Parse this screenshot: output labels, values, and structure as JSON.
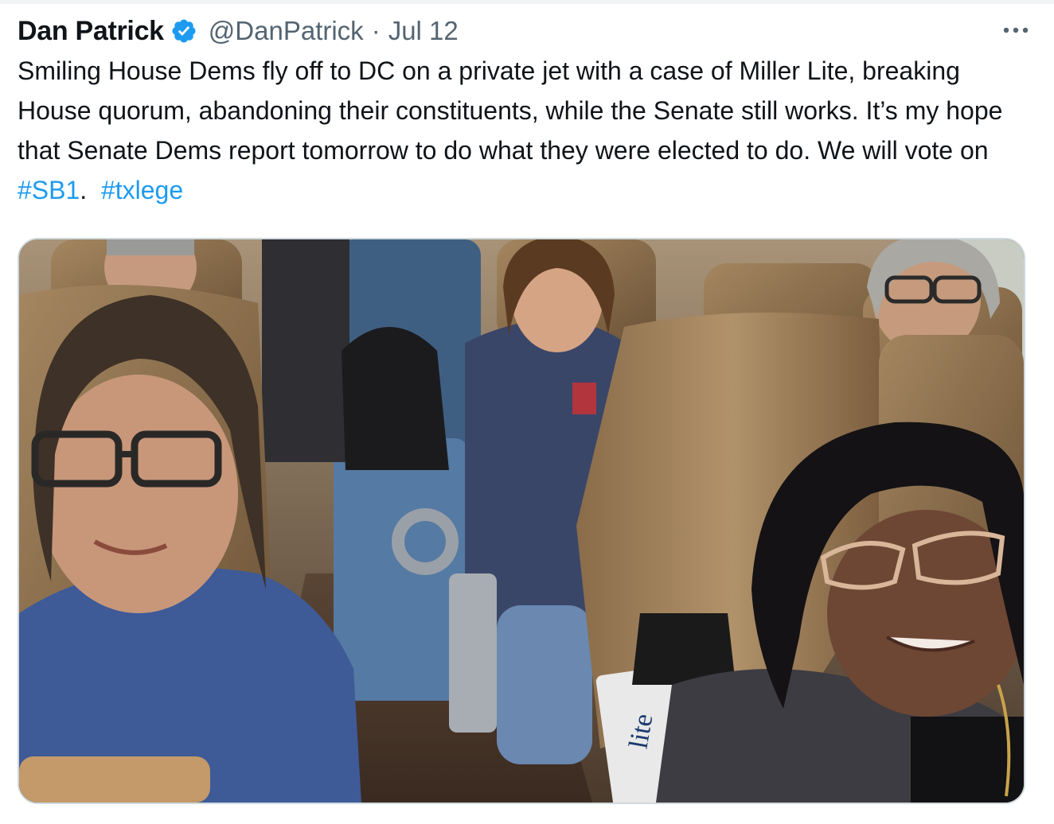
{
  "tweet": {
    "author": {
      "display_name": "Dan Patrick",
      "handle": "@DanPatrick",
      "verified": true
    },
    "separator": "·",
    "date": "Jul 12",
    "more_icon": "more-horizontal-icon",
    "text_parts": {
      "main": "Smiling House Dems fly off to DC on a private jet with a case of Miller Lite, breaking House quorum, abandoning their constituents, while the Senate still works. It’s my hope that Senate Dems report tomorrow to do what they were elected to do. We will vote on ",
      "hashtag1": "#SB1",
      "between": ".  ",
      "hashtag2": "#txlege"
    },
    "media": {
      "type": "photo",
      "beer_box_text": "lite"
    }
  },
  "colors": {
    "link": "#1d9bf0",
    "secondary_text": "#536471",
    "verified_badge": "#1d9bf0",
    "border": "#cfd9de"
  }
}
